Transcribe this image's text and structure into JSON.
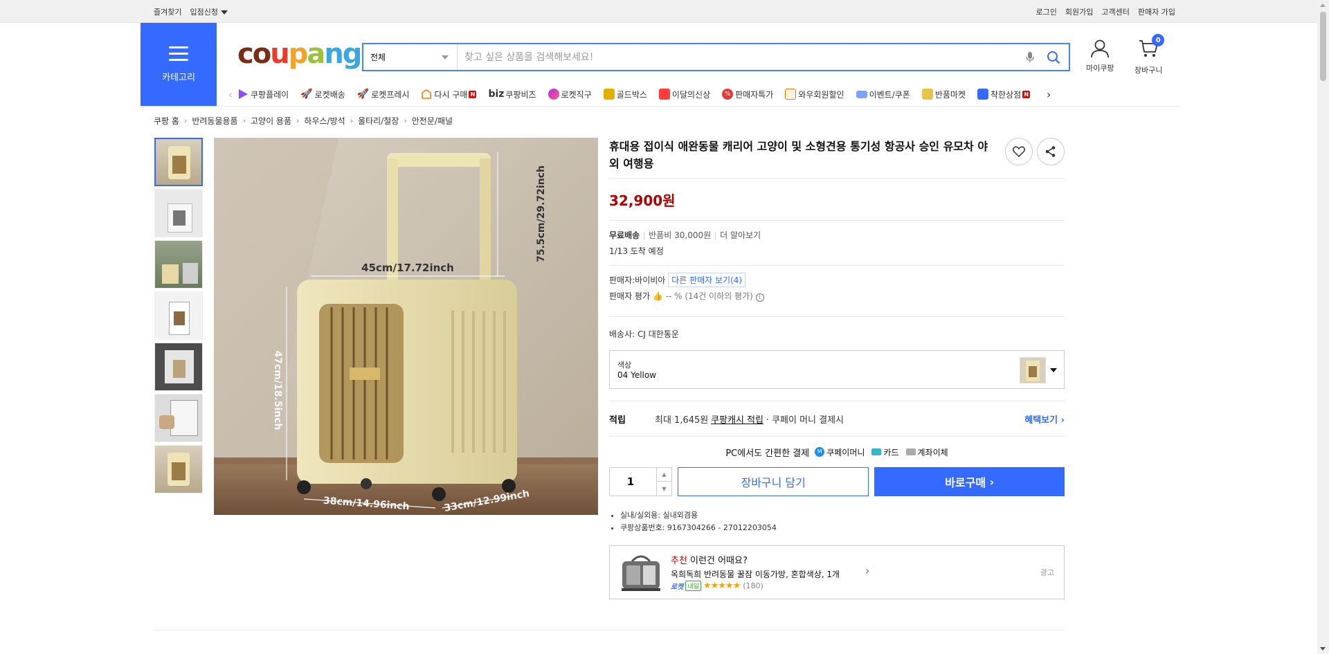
{
  "topbar": {
    "left": [
      "즐겨찾기",
      "입점신청"
    ],
    "right": [
      "로그인",
      "회원가입",
      "고객센터",
      "판매자 가입"
    ]
  },
  "header": {
    "category_label": "카테고리",
    "logo": {
      "c1": "co",
      "c2": "u",
      "c3": "p",
      "c4": "a",
      "c5": "ng"
    },
    "search_scope": "전체",
    "search_placeholder": "찾고 싶은 상품을 검색해보세요!",
    "mycoupang": "마이쿠팡",
    "cart": "장바구니",
    "cart_count": "0"
  },
  "quicknav": [
    {
      "label": "쿠팡플레이",
      "icon": "play-icon",
      "color": "#8a4bff"
    },
    {
      "label": "로켓배송",
      "icon": "rocket-icon",
      "color": "#346aff"
    },
    {
      "label": "로켓프레시",
      "icon": "rocket-fresh-icon",
      "color": "#3ea33e"
    },
    {
      "label": "다시 구매",
      "icon": "rebuy-icon",
      "color": "#ff7a00"
    },
    {
      "label": "쿠팡비즈",
      "icon": "biz-icon",
      "color": "#333333"
    },
    {
      "label": "로켓직구",
      "icon": "global-icon",
      "color": "#b12cdb"
    },
    {
      "label": "골드박스",
      "icon": "goldbox-icon",
      "color": "#d8a300"
    },
    {
      "label": "이달의신상",
      "icon": "new-icon",
      "color": "#ff3b3b"
    },
    {
      "label": "판매자특가",
      "icon": "discount-icon",
      "color": "#e53935"
    },
    {
      "label": "와우회원할인",
      "icon": "wow-icon",
      "color": "#f57c00"
    },
    {
      "label": "이벤트/쿠폰",
      "icon": "coupon-icon",
      "color": "#346aff"
    },
    {
      "label": "반품마켓",
      "icon": "return-market-icon",
      "color": "#d8a300"
    },
    {
      "label": "착한상점",
      "icon": "good-shop-icon",
      "color": "#346aff"
    }
  ],
  "breadcrumb": [
    "쿠팡 홈",
    "반려동물용품",
    "고양이 용품",
    "하우스/방석",
    "울타리/철장",
    "안전문/패널"
  ],
  "product": {
    "title": "휴대용 접이식 애완동물 캐리어 고양이 및 소형견용 통기성 항공사 승인 유모차 야외 여행용",
    "price": "32,900원",
    "shipping_free": "무료배송",
    "return_fee": "반품비 30,000원",
    "more": "더 알아보기",
    "arrival": "1/13 도착 예정",
    "seller_label": "판매자:",
    "seller_name": "바이비아",
    "other_sellers": "다른 판매자 보기(4)",
    "seller_rating_label": "판매자 평가",
    "seller_rating_value": "-- % (14건 이하의 평가)",
    "carrier_label": "배송사:",
    "carrier": "CJ 대한통운",
    "option_label": "색상",
    "option_value": "04 Yellow",
    "reward_label": "적립",
    "reward_text": "최대 1,645원",
    "reward_link": "쿠팡캐시 적립",
    "reward_tail": "· 쿠페이 머니 결제시",
    "benefit_link": "혜택보기",
    "pay_heading": "PC에서도 간편한 결제",
    "pay_methods": [
      "쿠페이머니",
      "카드",
      "계좌이체"
    ],
    "quantity": "1",
    "add_to_cart": "장바구니 담기",
    "buy_now": "바로구매",
    "bullets": [
      "실내/실외용: 실내외겸용",
      "쿠팡상품번호: 9167304266 - 27012203054"
    ]
  },
  "image_labels": {
    "width": "45cm/17.72inch",
    "height_total": "75.5cm/29.72inch",
    "height_body": "47cm/18.5inch",
    "depth": "38cm/14.96inch",
    "depth2": "33cm/12.99inch"
  },
  "recommendation": {
    "highlight": "추천",
    "heading": " 이런건 어때요?",
    "name": "옥희독희 반려동물 꿀잠 이동가방, 혼합색상, 1개",
    "rocket": "로켓",
    "tag": "내일",
    "rating": 4.5,
    "stars": "★★★★★",
    "count": "(180)",
    "ad": "광고"
  }
}
